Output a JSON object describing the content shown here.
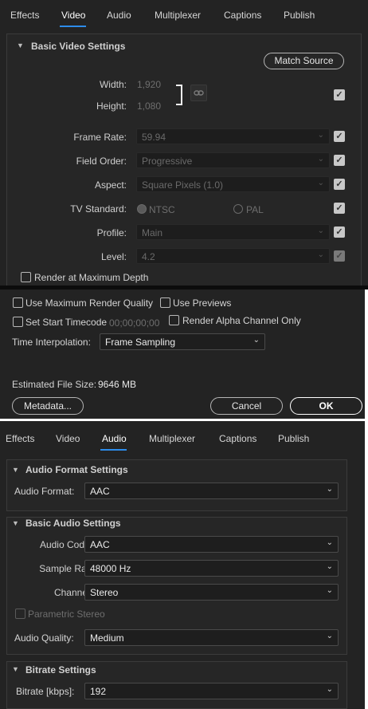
{
  "video_panel": {
    "tabs": [
      "Effects",
      "Video",
      "Audio",
      "Multiplexer",
      "Captions",
      "Publish"
    ],
    "active_tab": "Video",
    "section_title": "Basic Video Settings",
    "match_source": "Match Source",
    "width_label": "Width:",
    "width_value": "1,920",
    "height_label": "Height:",
    "height_value": "1,080",
    "frame_rate": {
      "label": "Frame Rate:",
      "value": "59.94"
    },
    "field_order": {
      "label": "Field Order:",
      "value": "Progressive"
    },
    "aspect": {
      "label": "Aspect:",
      "value": "Square Pixels (1.0)"
    },
    "tv_standard": {
      "label": "TV Standard:",
      "ntsc": "NTSC",
      "pal": "PAL"
    },
    "profile": {
      "label": "Profile:",
      "value": "Main"
    },
    "level": {
      "label": "Level:",
      "value": "4.2"
    },
    "render_max_depth": "Render at Maximum Depth"
  },
  "export_options": {
    "use_max_render_quality": "Use Maximum Render Quality",
    "use_previews": "Use Previews",
    "set_start_timecode": "Set Start Timecode",
    "timecode_value": "00;00;00;00",
    "render_alpha_only": "Render Alpha Channel Only",
    "time_interpolation_label": "Time Interpolation:",
    "time_interpolation_value": "Frame Sampling",
    "file_size_label": "Estimated File Size:",
    "file_size_value": "9646 MB",
    "metadata_button": "Metadata...",
    "cancel_button": "Cancel",
    "ok_button": "OK"
  },
  "audio_panel": {
    "tabs": [
      "Effects",
      "Video",
      "Audio",
      "Multiplexer",
      "Captions",
      "Publish"
    ],
    "active_tab": "Audio",
    "format_section": "Audio Format Settings",
    "audio_format": {
      "label": "Audio Format:",
      "value": "AAC"
    },
    "basic_section": "Basic Audio Settings",
    "audio_codec": {
      "label": "Audio Codec:",
      "value": "AAC"
    },
    "sample_rate": {
      "label": "Sample Rate:",
      "value": "48000 Hz"
    },
    "channels": {
      "label": "Channels:",
      "value": "Stereo"
    },
    "parametric_stereo": "Parametric Stereo",
    "audio_quality": {
      "label": "Audio Quality:",
      "value": "Medium"
    },
    "bitrate_section": "Bitrate Settings",
    "bitrate": {
      "label": "Bitrate [kbps]:",
      "value": "192"
    }
  },
  "colors": {
    "accent": "#2d8ceb",
    "panel": "#232323"
  }
}
